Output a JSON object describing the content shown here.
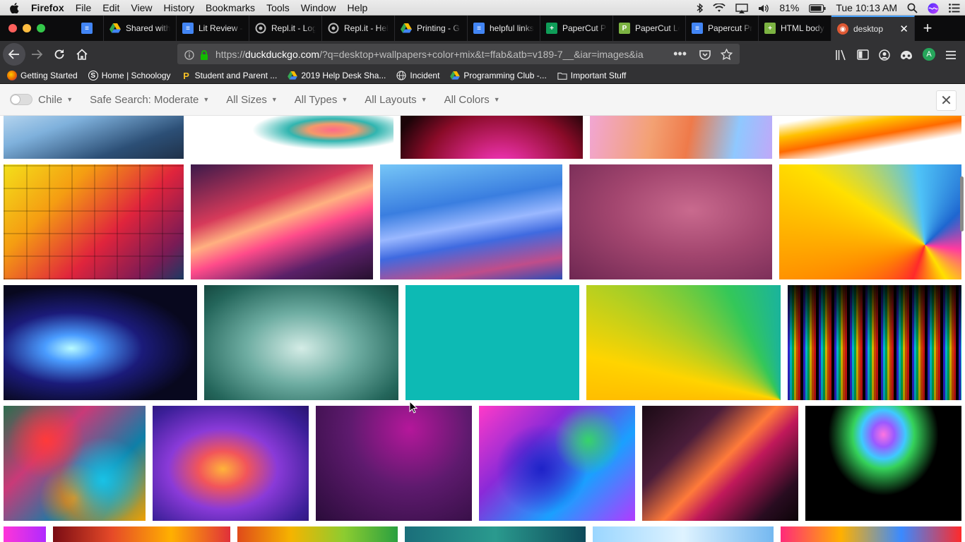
{
  "menubar": {
    "app": "Firefox",
    "items": [
      "File",
      "Edit",
      "View",
      "History",
      "Bookmarks",
      "Tools",
      "Window",
      "Help"
    ],
    "battery": "81%",
    "clock": "Tue 10:13 AM"
  },
  "tabs": [
    {
      "label": "",
      "icon": "docs-icon",
      "color": "#4285f4"
    },
    {
      "label": "Shared with",
      "icon": "drive-icon",
      "color": "#34a853"
    },
    {
      "label": "Lit Review -",
      "icon": "docs-icon",
      "color": "#4285f4"
    },
    {
      "label": "Repl.it - Log",
      "icon": "replit-icon",
      "color": "#888888"
    },
    {
      "label": "Repl.it - Hel",
      "icon": "replit-icon",
      "color": "#888888"
    },
    {
      "label": "Printing - G",
      "icon": "drive-icon",
      "color": "#34a853"
    },
    {
      "label": "helpful links",
      "icon": "docs-icon",
      "color": "#4285f4"
    },
    {
      "label": "PaperCut P",
      "icon": "sheets-icon",
      "color": "#0f9d58"
    },
    {
      "label": "PaperCut Lo",
      "icon": "papercut-icon",
      "color": "#7cb342"
    },
    {
      "label": "Papercut Pr",
      "icon": "docs-icon",
      "color": "#4285f4"
    },
    {
      "label": "HTML body",
      "icon": "sheets-icon",
      "color": "#7cb342"
    },
    {
      "label": "desktop",
      "icon": "duckduckgo-icon",
      "color": "#de5833"
    }
  ],
  "navbar": {
    "url_prefix": "https://",
    "url_host": "duckduckgo.com",
    "url_rest": "/?q=desktop+wallpapers+color+mix&t=ffab&atb=v189-7__&iar=images&ia",
    "account_initial": "A"
  },
  "bookmarks": [
    {
      "label": "Getting Started",
      "icon": "firefox-icon",
      "color": "#e66000"
    },
    {
      "label": "Home | Schoology",
      "icon": "schoology-icon",
      "color": "#ffffff"
    },
    {
      "label": "Student and Parent ...",
      "icon": "powerschool-icon",
      "color": "#f6c026"
    },
    {
      "label": "2019 Help Desk Sha...",
      "icon": "drive-icon",
      "color": "#34a853"
    },
    {
      "label": "Incident",
      "icon": "globe-icon",
      "color": "#cccccc"
    },
    {
      "label": "Programming Club -...",
      "icon": "drive-icon",
      "color": "#34a853"
    },
    {
      "label": "Important Stuff",
      "icon": "folder-icon",
      "color": "#cccccc"
    }
  ],
  "filters": {
    "region": "Chile",
    "safe_search": "Safe Search: Moderate",
    "size": "All Sizes",
    "type": "All Types",
    "layout": "All Layouts",
    "color": "All Colors"
  }
}
